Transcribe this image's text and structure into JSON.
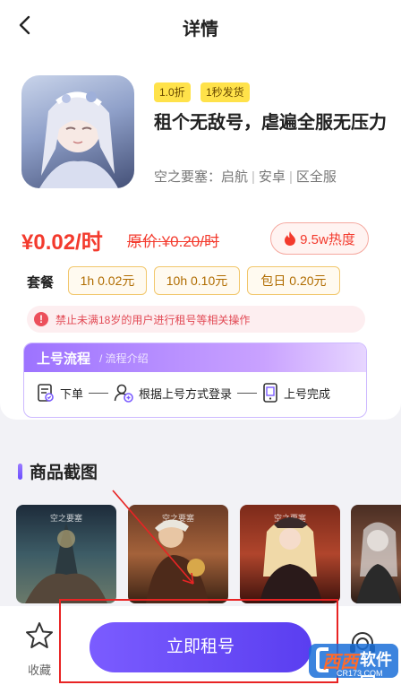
{
  "header": {
    "title": "详情"
  },
  "game": {
    "tags": [
      "1.0折",
      "1秒发货"
    ],
    "title": "租个无敌号，虐遍全服无压力",
    "game_name": "空之要塞：启航",
    "platform": "安卓",
    "server": "区全服"
  },
  "pricing": {
    "price": "¥0.02/时",
    "original_price": "原价:¥0.20/时",
    "heat": "9.5w热度"
  },
  "packages": {
    "label": "套餐",
    "items": [
      "1h 0.02元",
      "10h 0.10元",
      "包日 0.20元"
    ]
  },
  "warning": {
    "text": "禁止未满18岁的用户进行租号等相关操作"
  },
  "flow": {
    "title": "上号流程",
    "intro": "/  流程介绍",
    "steps": [
      "下单",
      "根据上号方式登录",
      "上号完成"
    ]
  },
  "screenshots": {
    "title": "商品截图",
    "logo_text": "空之要塞"
  },
  "bottom": {
    "favorite_label": "收藏",
    "rent_button": "立即租号"
  },
  "watermark": {
    "text1": "西西",
    "text2": "软件园",
    "url": "CR173.COM"
  },
  "colors": {
    "accent": "#6b4dff",
    "price": "#f33a2d",
    "tag": "#ffe24a"
  }
}
